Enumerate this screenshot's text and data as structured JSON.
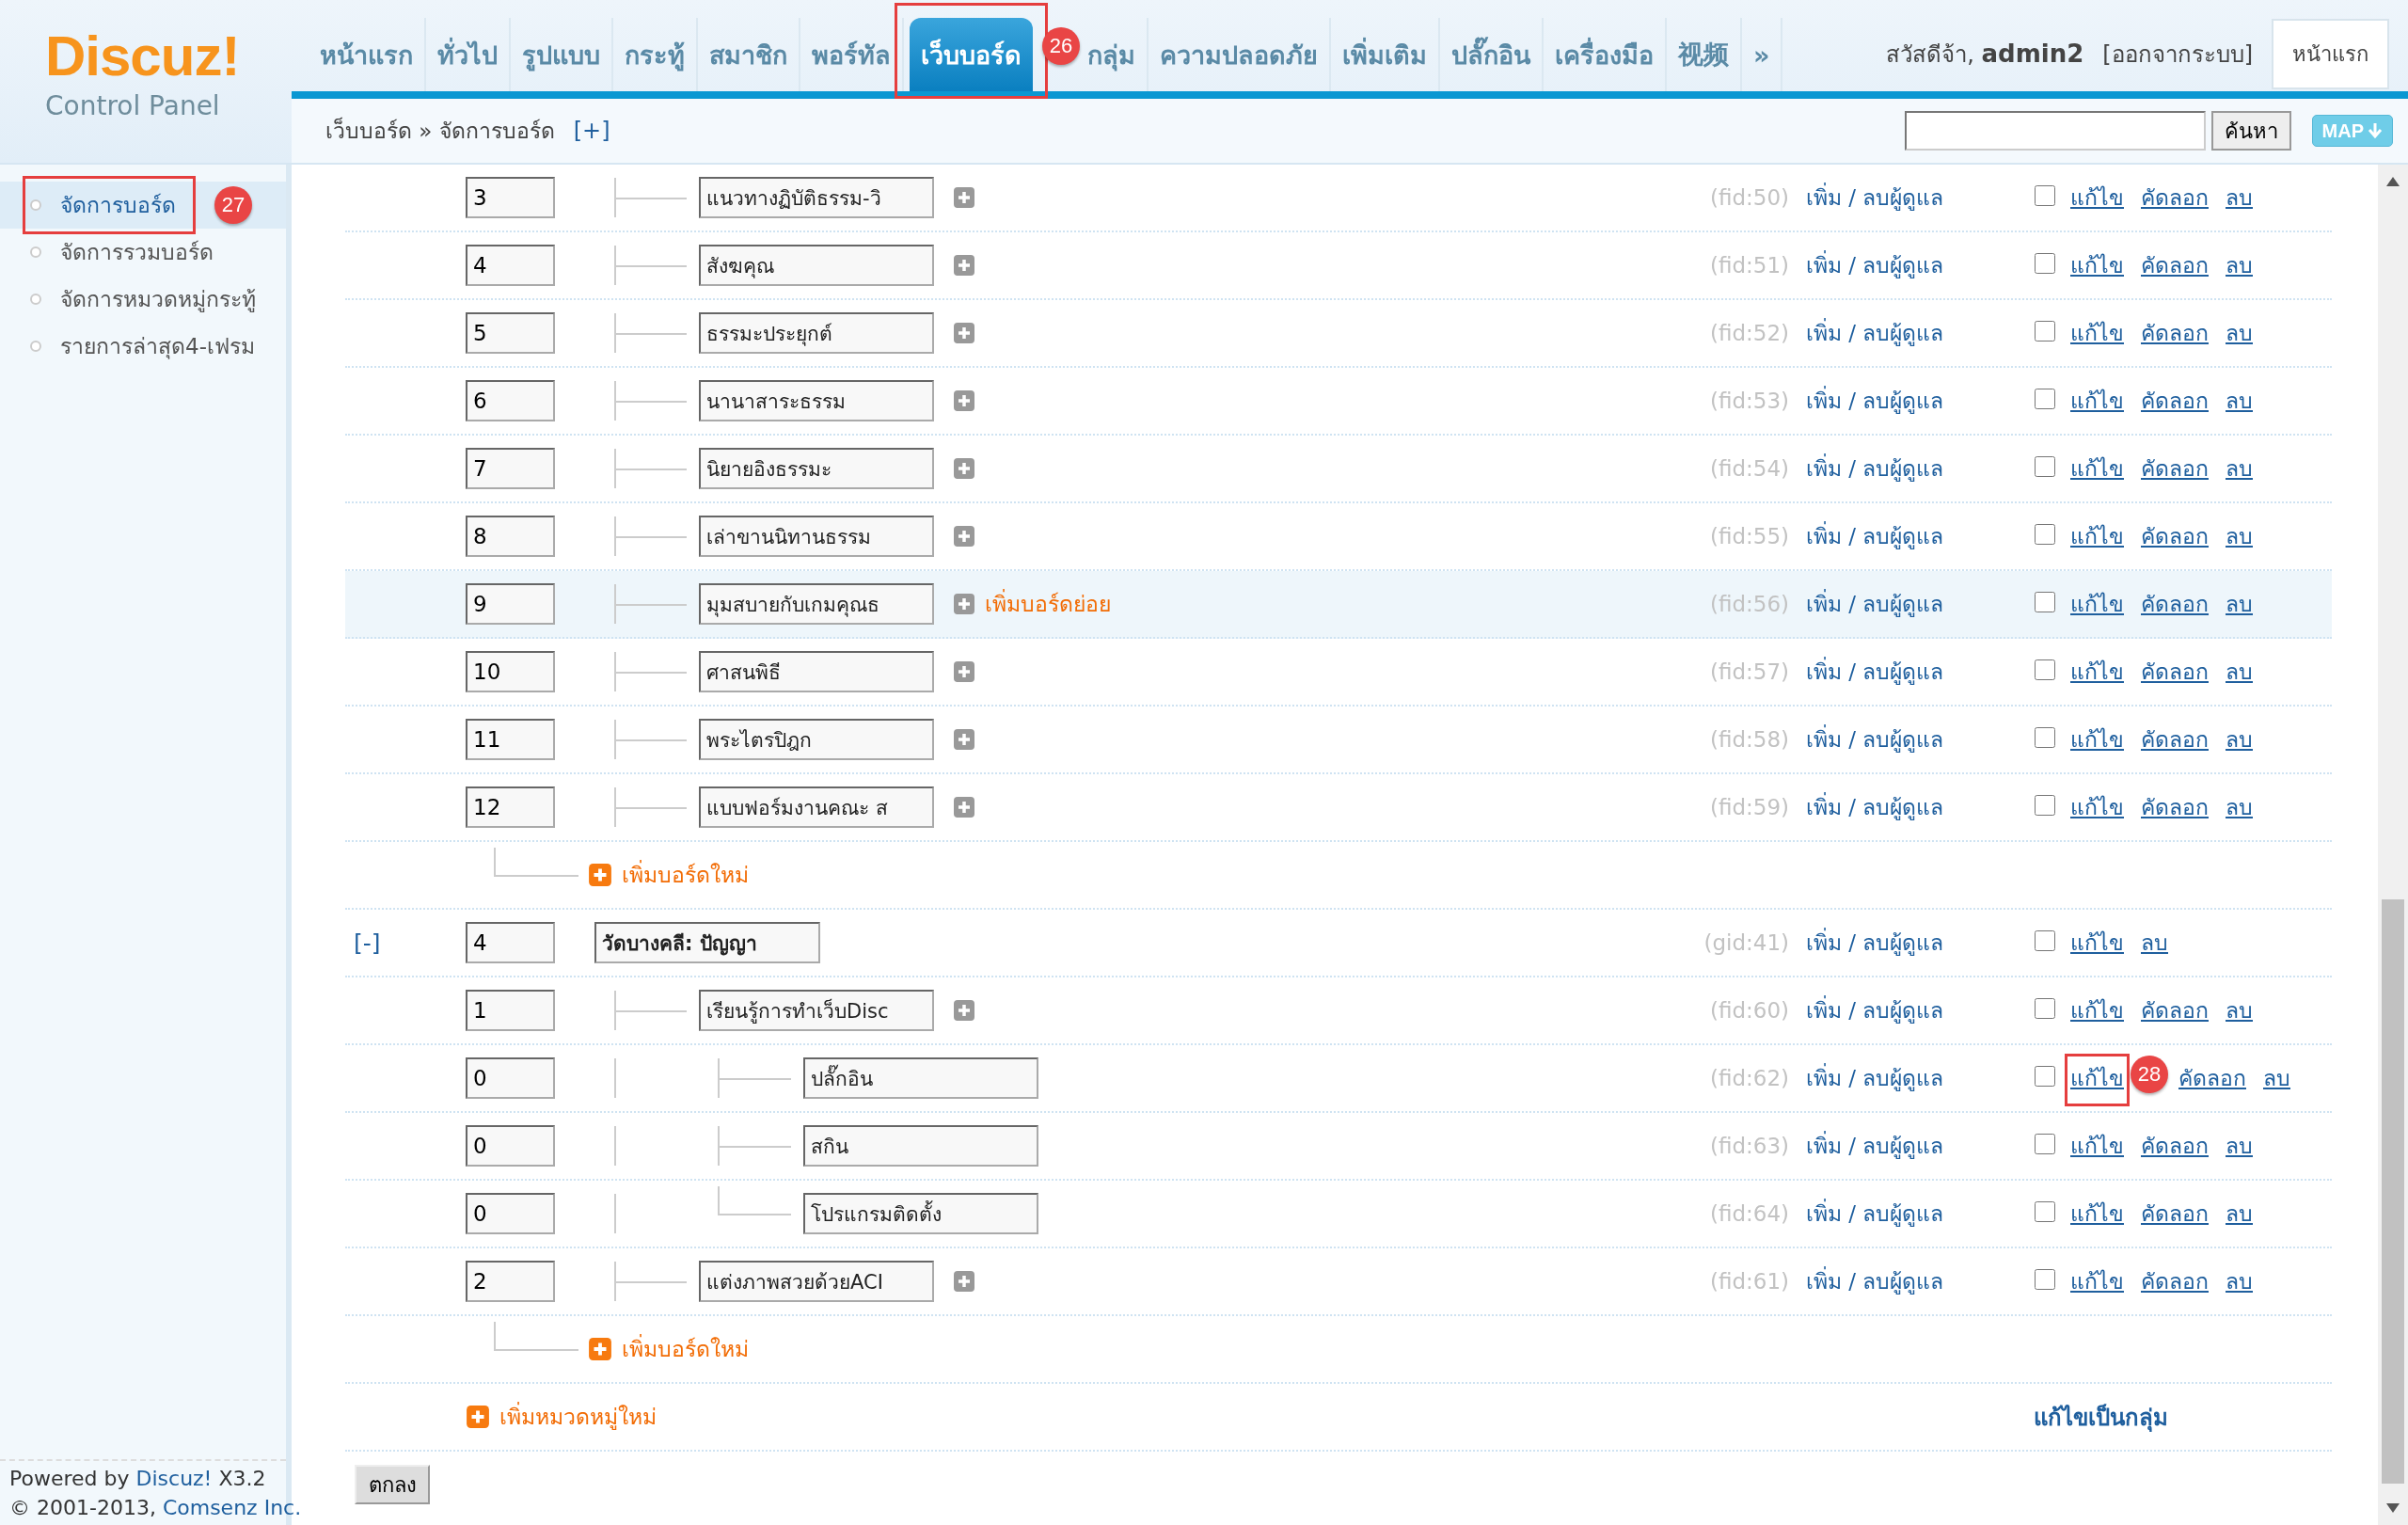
{
  "logo": {
    "brand": "Discuz!",
    "subtitle": "Control Panel"
  },
  "nav": [
    {
      "label": "หน้าแรก",
      "selected": false
    },
    {
      "label": "ทั่วไป",
      "selected": false
    },
    {
      "label": "รูปแบบ",
      "selected": false
    },
    {
      "label": "กระทู้",
      "selected": false
    },
    {
      "label": "สมาชิก",
      "selected": false
    },
    {
      "label": "พอร์ทัล",
      "selected": false
    },
    {
      "label": "เว็บบอร์ด",
      "selected": true,
      "callout": "26"
    },
    {
      "label": "กลุ่ม",
      "selected": false
    },
    {
      "label": "ความปลอดภัย",
      "selected": false
    },
    {
      "label": "เพิ่มเติม",
      "selected": false
    },
    {
      "label": "ปลั๊กอิน",
      "selected": false
    },
    {
      "label": "เครื่องมือ",
      "selected": false
    },
    {
      "label": "视频",
      "selected": false
    },
    {
      "label": "»",
      "selected": false
    }
  ],
  "user": {
    "greeting": "สวัสดีจ้า,",
    "name": "admin2",
    "logout": "[ออกจากระบบ]",
    "home_button": "หน้าแรก"
  },
  "breadcrumb": {
    "path": "เว็บบอร์ด » จัดการบอร์ด",
    "add": "[+]"
  },
  "search": {
    "button": "ค้นหา",
    "map": "MAP"
  },
  "sidebar": [
    {
      "label": "จัดการบอร์ด",
      "selected": true,
      "callout": "27"
    },
    {
      "label": "จัดการรวมบอร์ด",
      "selected": false
    },
    {
      "label": "จัดการหมวดหมู่กระทู้",
      "selected": false
    },
    {
      "label": "รายการล่าสุด4-เฟรม",
      "selected": false
    }
  ],
  "footer": {
    "powered": "Powered by",
    "product": "Discuz!",
    "version": "X3.2",
    "copyright": "© 2001-2013,",
    "company": "Comsenz Inc."
  },
  "groups": [
    {
      "forums": [
        {
          "order": "3",
          "name": "แนวทางฏิบัติธรรม-วิ",
          "id": "(fid:50)",
          "moderators": "เพิ่ม / ลบผู้ดูแล",
          "checked": false,
          "highlighted": false,
          "actions": [
            {
              "label": "แก้ไข"
            },
            {
              "label": "คัดลอก"
            },
            {
              "label": "ลบ"
            }
          ]
        },
        {
          "order": "4",
          "name": "สังฆคุณ",
          "id": "(fid:51)",
          "moderators": "เพิ่ม / ลบผู้ดูแล",
          "checked": false,
          "highlighted": false,
          "actions": [
            {
              "label": "แก้ไข"
            },
            {
              "label": "คัดลอก"
            },
            {
              "label": "ลบ"
            }
          ]
        },
        {
          "order": "5",
          "name": "ธรรมะประยุกต์",
          "id": "(fid:52)",
          "moderators": "เพิ่ม / ลบผู้ดูแล",
          "checked": false,
          "highlighted": false,
          "actions": [
            {
              "label": "แก้ไข"
            },
            {
              "label": "คัดลอก"
            },
            {
              "label": "ลบ"
            }
          ]
        },
        {
          "order": "6",
          "name": "นานาสาระธรรม",
          "id": "(fid:53)",
          "moderators": "เพิ่ม / ลบผู้ดูแล",
          "checked": false,
          "highlighted": false,
          "actions": [
            {
              "label": "แก้ไข"
            },
            {
              "label": "คัดลอก"
            },
            {
              "label": "ลบ"
            }
          ]
        },
        {
          "order": "7",
          "name": "นิยายอิงธรรมะ",
          "id": "(fid:54)",
          "moderators": "เพิ่ม / ลบผู้ดูแล",
          "checked": false,
          "highlighted": false,
          "actions": [
            {
              "label": "แก้ไข"
            },
            {
              "label": "คัดลอก"
            },
            {
              "label": "ลบ"
            }
          ]
        },
        {
          "order": "8",
          "name": "เล่าขานนิทานธรรม",
          "id": "(fid:55)",
          "moderators": "เพิ่ม / ลบผู้ดูแล",
          "checked": false,
          "highlighted": false,
          "actions": [
            {
              "label": "แก้ไข"
            },
            {
              "label": "คัดลอก"
            },
            {
              "label": "ลบ"
            }
          ]
        },
        {
          "order": "9",
          "name": "มุมสบายกับเกมคุณธ",
          "id": "(fid:56)",
          "moderators": "เพิ่ม / ลบผู้ดูแล",
          "checked": false,
          "highlighted": true,
          "add_sub": "เพิ่มบอร์ดย่อย",
          "actions": [
            {
              "label": "แก้ไข"
            },
            {
              "label": "คัดลอก"
            },
            {
              "label": "ลบ"
            }
          ]
        },
        {
          "order": "10",
          "name": "ศาสนพิธี",
          "id": "(fid:57)",
          "moderators": "เพิ่ม / ลบผู้ดูแล",
          "checked": false,
          "highlighted": false,
          "actions": [
            {
              "label": "แก้ไข"
            },
            {
              "label": "คัดลอก"
            },
            {
              "label": "ลบ"
            }
          ]
        },
        {
          "order": "11",
          "name": "พระไตรปิฎก",
          "id": "(fid:58)",
          "moderators": "เพิ่ม / ลบผู้ดูแล",
          "checked": false,
          "highlighted": false,
          "actions": [
            {
              "label": "แก้ไข"
            },
            {
              "label": "คัดลอก"
            },
            {
              "label": "ลบ"
            }
          ]
        },
        {
          "order": "12",
          "name": "แบบฟอร์มงานคณะ ส",
          "id": "(fid:59)",
          "moderators": "เพิ่ม / ลบผู้ดูแล",
          "checked": false,
          "highlighted": false,
          "actions": [
            {
              "label": "แก้ไข"
            },
            {
              "label": "คัดลอก"
            },
            {
              "label": "ลบ"
            }
          ]
        }
      ],
      "add_board": "เพิ่มบอร์ดใหม่"
    },
    {
      "header": {
        "toggle": "[-]",
        "order": "4",
        "name": "วัดบางคลี: ปัญญา",
        "id": "(gid:41)",
        "moderators": "เพิ่ม / ลบผู้ดูแล",
        "checked": false,
        "actions": [
          {
            "label": "แก้ไข"
          },
          {
            "label": "ลบ"
          }
        ]
      },
      "forums": [
        {
          "order": "1",
          "name": "เรียนรู้การทำเว็บDisc",
          "id": "(fid:60)",
          "moderators": "เพิ่ม / ลบผู้ดูแล",
          "checked": false,
          "highlighted": false,
          "actions": [
            {
              "label": "แก้ไข"
            },
            {
              "label": "คัดลอก"
            },
            {
              "label": "ลบ"
            }
          ],
          "children": [
            {
              "order": "0",
              "name": "ปลั๊กอิน",
              "id": "(fid:62)",
              "moderators": "เพิ่ม / ลบผู้ดูแล",
              "checked": false,
              "highlighted": false,
              "actions": [
                {
                  "label": "แก้ไข",
                  "callout": "28"
                },
                {
                  "label": "คัดลอก"
                },
                {
                  "label": "ลบ"
                }
              ]
            },
            {
              "order": "0",
              "name": "สกิน",
              "id": "(fid:63)",
              "moderators": "เพิ่ม / ลบผู้ดูแล",
              "checked": false,
              "highlighted": false,
              "actions": [
                {
                  "label": "แก้ไข"
                },
                {
                  "label": "คัดลอก"
                },
                {
                  "label": "ลบ"
                }
              ]
            },
            {
              "order": "0",
              "name": "โปรแกรมติดตั้ง",
              "id": "(fid:64)",
              "moderators": "เพิ่ม / ลบผู้ดูแล",
              "checked": false,
              "highlighted": false,
              "actions": [
                {
                  "label": "แก้ไข"
                },
                {
                  "label": "คัดลอก"
                },
                {
                  "label": "ลบ"
                }
              ]
            }
          ]
        },
        {
          "order": "2",
          "name": "แต่งภาพสวยด้วยACI",
          "id": "(fid:61)",
          "moderators": "เพิ่ม / ลบผู้ดูแล",
          "checked": false,
          "highlighted": false,
          "actions": [
            {
              "label": "แก้ไข"
            },
            {
              "label": "คัดลอก"
            },
            {
              "label": "ลบ"
            }
          ]
        }
      ],
      "add_board": "เพิ่มบอร์ดใหม่"
    }
  ],
  "add_category": "เพิ่มหมวดหมู่ใหม่",
  "group_edit": "แก้ไขเป็นกลุ่ม",
  "submit": "ตกลง"
}
